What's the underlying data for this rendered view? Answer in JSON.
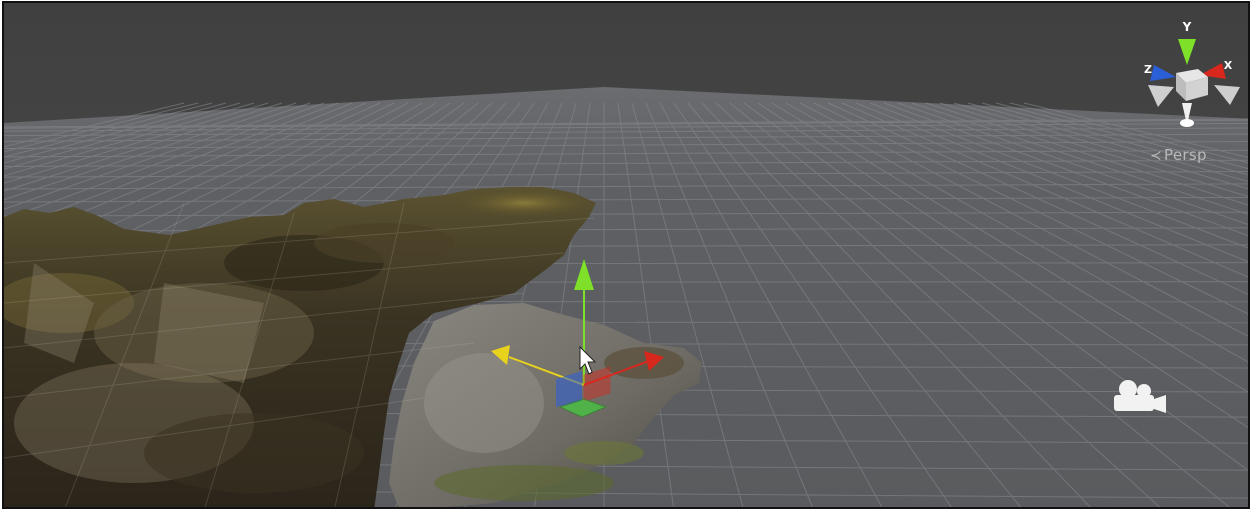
{
  "viewport": {
    "projection_label": "Persp",
    "gizmo_axis_labels": {
      "x": "X",
      "y": "Y",
      "z": "Z"
    }
  },
  "colors": {
    "sky": "#464646",
    "ground": "#5b5d60",
    "grid_line": "#8a8c90",
    "axis_x": "#d8281e",
    "axis_y": "#7fe02a",
    "axis_z": "#2a5fd8",
    "axis_free": "#e8d21c"
  },
  "icons": {
    "orientation_gizmo": "view-orientation-gizmo-icon",
    "camera": "scene-camera-icon",
    "cursor": "mouse-pointer-icon"
  }
}
